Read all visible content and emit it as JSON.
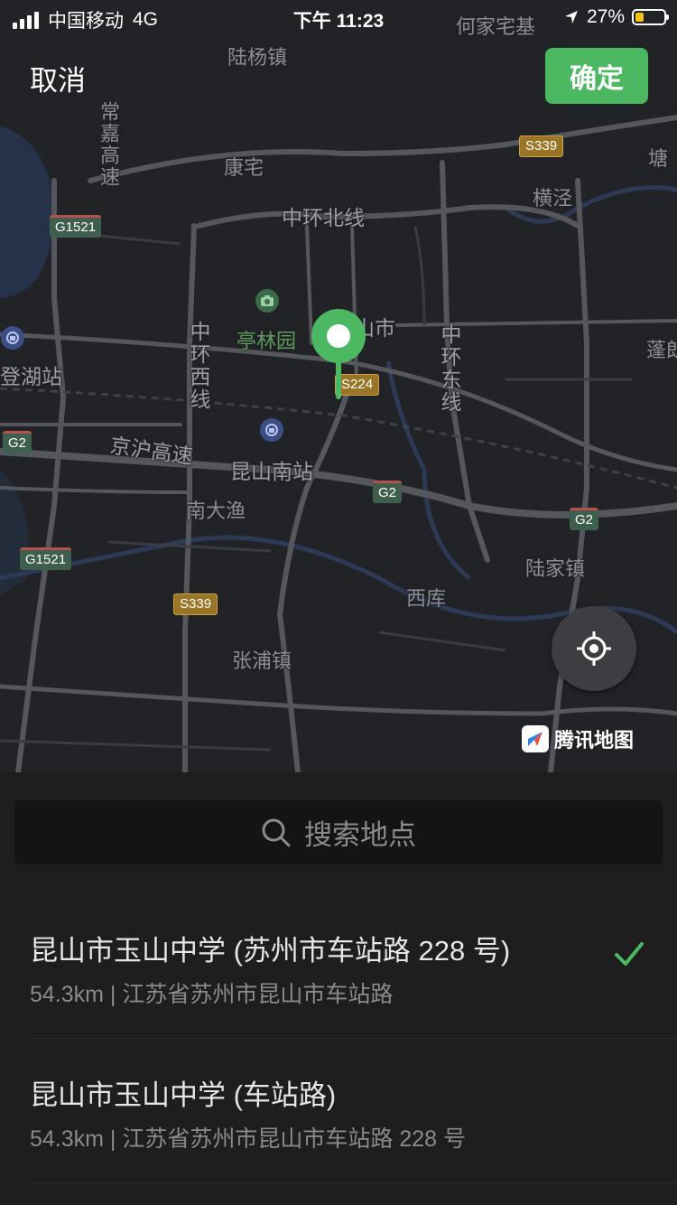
{
  "status_bar": {
    "carrier": "中国移动",
    "network": "4G",
    "time": "下午 11:23",
    "battery_percent": "27%"
  },
  "header": {
    "cancel_label": "取消",
    "confirm_label": "确定"
  },
  "map": {
    "places": {
      "hejiazhai": "何家宅基",
      "luyang": "陆杨镇",
      "kangzhai": "康宅",
      "changjia": "常嘉高速",
      "zhonghuan_bei": "中环北线",
      "hengjing": "横泾",
      "tanghou": "塘",
      "tinglinyuan": "亭林园",
      "city": "山市",
      "zhonghuan_xi": "中环西线",
      "zhonghuan_dong": "中环东线",
      "penglang": "蓬朗",
      "denghu": "登湖站",
      "jinghu": "京沪高速",
      "kunshan_south": "昆山南站",
      "nandayu": "南大渔",
      "lujia": "陆家镇",
      "xiku": "西库",
      "zhangpu": "张浦镇"
    },
    "shields": {
      "s339_top": "S339",
      "g1521_top": "G1521",
      "s224": "S224",
      "g2_left": "G2",
      "g2_mid": "G2",
      "g2_right": "G2",
      "g1521_bottom": "G1521",
      "s339_bottom": "S339"
    },
    "brand": "腾讯地图"
  },
  "search": {
    "placeholder": "搜索地点"
  },
  "results": [
    {
      "title": "昆山市玉山中学 (苏州市车站路 228 号)",
      "subtitle": "54.3km | 江苏省苏州市昆山市车站路",
      "selected": true
    },
    {
      "title": "昆山市玉山中学 (车站路)",
      "subtitle": "54.3km | 江苏省苏州市昆山市车站路 228 号",
      "selected": false
    }
  ],
  "colors": {
    "accent": "#4cb862",
    "map_bg": "#222327",
    "sheet_bg": "#1e1e1e"
  }
}
